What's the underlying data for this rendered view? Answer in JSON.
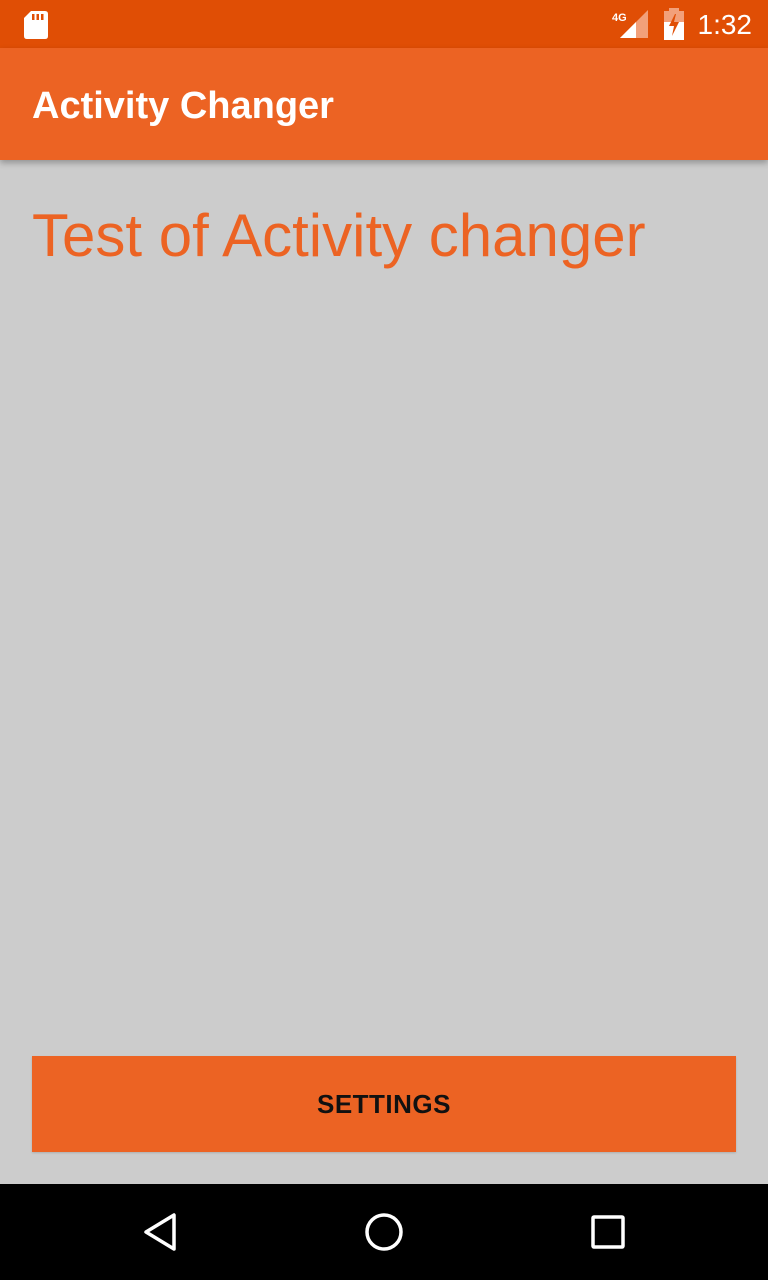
{
  "status_bar": {
    "network_label": "4G",
    "time": "1:32",
    "icons": [
      "sd-card-icon",
      "cellular-signal-icon",
      "battery-charging-icon"
    ],
    "background_color": "#e04e05"
  },
  "app_bar": {
    "title": "Activity Changer",
    "background_color": "#ec6323"
  },
  "main": {
    "heading": "Test of Activity changer",
    "heading_color": "#ec6323",
    "background_color": "#cccccc"
  },
  "settings_button": {
    "label": "SETTINGS",
    "background_color": "#ec6323"
  },
  "nav_bar": {
    "buttons": [
      "back-icon",
      "home-icon",
      "recents-icon"
    ],
    "background_color": "#000000"
  }
}
